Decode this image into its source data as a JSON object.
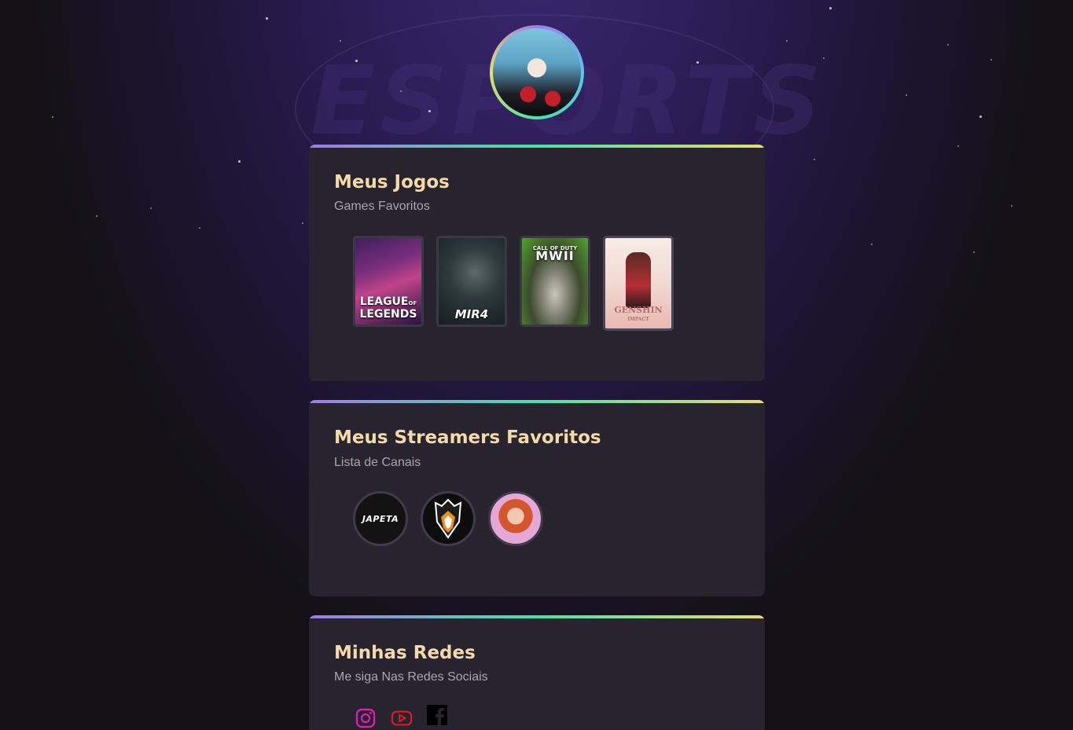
{
  "games": {
    "title": "Meus Jogos",
    "subtitle": "Games Favoritos",
    "items": [
      {
        "name": "LEAGUE OF LEGENDS",
        "caption_line1": "LEAGUE",
        "caption_of": "OF",
        "caption_line2": "LEGENDS"
      },
      {
        "name": "MIR4",
        "caption_line1": "MIR4"
      },
      {
        "name": "Call of Duty MWII",
        "caption_top": "CALL OF DUTY",
        "caption_line1": "MWII"
      },
      {
        "name": "Genshin Impact",
        "caption_line1": "GENSHIN",
        "caption_line2": "IMPACT"
      }
    ]
  },
  "streamers": {
    "title": "Meus Streamers Favoritos",
    "subtitle": "Lista de Canais",
    "items": [
      {
        "name": "JAPETA",
        "label": "JAPETA"
      },
      {
        "name": "lion-crest",
        "label": ""
      },
      {
        "name": "red-hair-streamer",
        "label": ""
      }
    ]
  },
  "social": {
    "title": "Minhas Redes",
    "subtitle": "Me siga Nas Redes Sociais",
    "links": [
      {
        "icon": "instagram-icon",
        "color": "#e11fb3"
      },
      {
        "icon": "youtube-icon",
        "color": "#e01b24"
      },
      {
        "icon": "facebook-icon",
        "color": "#000000"
      }
    ]
  },
  "colors": {
    "card_bg": "#28242f",
    "title": "#f5d9a7",
    "subtitle": "#a9a3b3",
    "accent_gradient": [
      "#9f7aea",
      "#48e2a4",
      "#e8dd6f"
    ]
  }
}
